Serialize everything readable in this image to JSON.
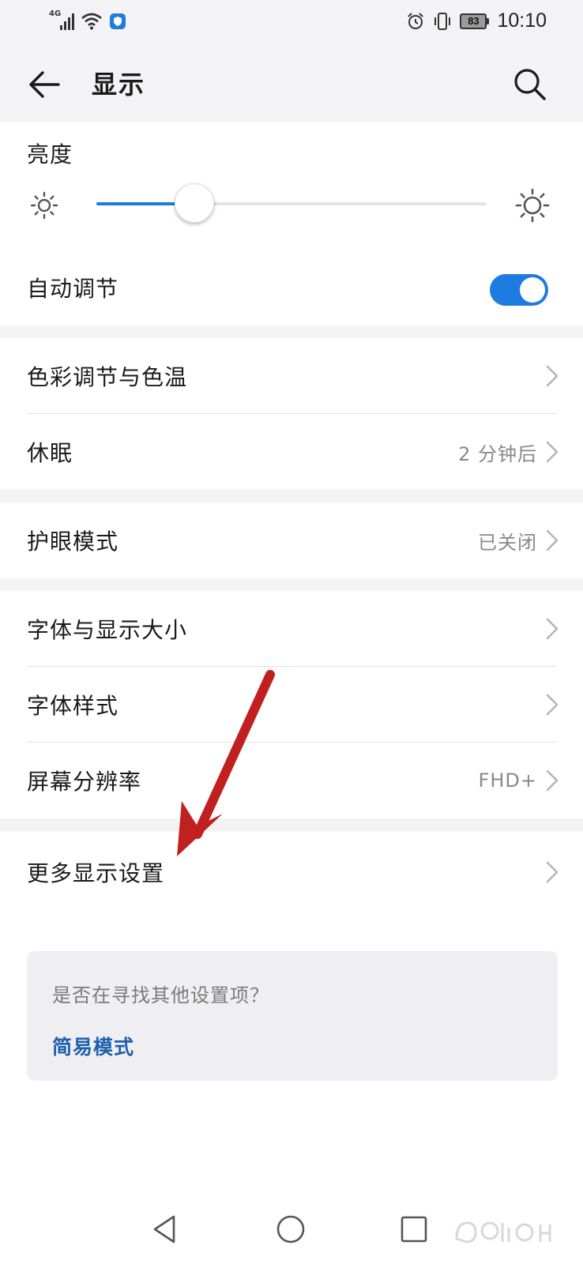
{
  "status_bar": {
    "network": "4G",
    "time": "10:10",
    "battery": "83"
  },
  "header": {
    "title": "显示"
  },
  "brightness": {
    "title": "亮度",
    "level": 0.25,
    "accent": "#1e7be0"
  },
  "auto_adjust": {
    "label": "自动调节",
    "enabled": true
  },
  "items": [
    {
      "label": "色彩调节与色温",
      "value": ""
    },
    {
      "label": "休眠",
      "value": "2 分钟后"
    },
    {
      "label": "护眼模式",
      "value": "已关闭"
    },
    {
      "label": "字体与显示大小",
      "value": ""
    },
    {
      "label": "字体样式",
      "value": ""
    },
    {
      "label": "屏幕分辨率",
      "value": "FHD+"
    },
    {
      "label": "更多显示设置",
      "value": ""
    }
  ],
  "suggestion": {
    "question": "是否在寻找其他设置项？",
    "link": "简易模式"
  },
  "icons": {
    "back": "arrow-left-icon",
    "search": "search-icon",
    "chevron": "chevron-right-icon",
    "nav_back": "triangle-back-icon",
    "nav_home": "circle-home-icon",
    "nav_recents": "square-recents-icon"
  },
  "annotation_color": "#c0201f"
}
